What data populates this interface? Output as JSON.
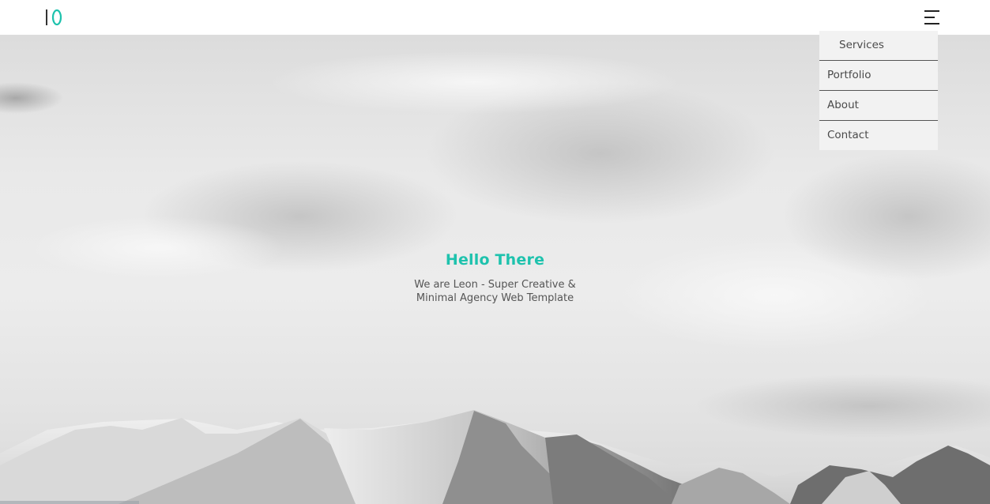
{
  "brand": {
    "logo_icon": "leon-logo-icon",
    "accent_color": "#1ec2ad"
  },
  "header": {
    "menu_icon": "hamburger-menu-icon"
  },
  "nav": {
    "items": [
      {
        "label": "Services"
      },
      {
        "label": "Portfolio"
      },
      {
        "label": "About"
      },
      {
        "label": "Contact"
      }
    ]
  },
  "hero": {
    "title": "Hello There",
    "subtitle": "We are Leon - Super Creative & Minimal Agency Web Template",
    "background": "snowy-mountains-cloudy-sky"
  }
}
